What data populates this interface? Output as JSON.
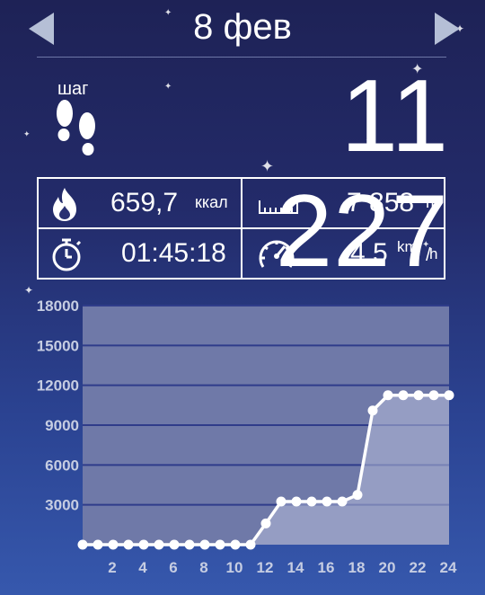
{
  "header": {
    "date": "8 фев"
  },
  "steps": {
    "label": "шаг",
    "value": "11 227"
  },
  "stats": {
    "calories": {
      "value": "659,7",
      "unit": "ккал"
    },
    "distance": {
      "value": "7 858",
      "unit": "m"
    },
    "duration": {
      "value": "01:45:18"
    },
    "speed": {
      "value": "4,5",
      "unit_top": "km",
      "unit_bottom": "h"
    }
  },
  "icons": {
    "prev": "triangle-left-icon",
    "next": "triangle-right-icon",
    "steps": "footprints-icon",
    "calories": "flame-icon",
    "distance": "ruler-icon",
    "duration": "stopwatch-icon",
    "speed": "speedometer-icon"
  },
  "colors": {
    "plot_area": "#6f79a8",
    "line": "#ffffff",
    "tick_label": "#c6cde2",
    "gridline": "#2f3c8a"
  },
  "chart_data": {
    "type": "line",
    "title": "",
    "xlabel": "",
    "ylabel": "",
    "ylim": [
      0,
      18000
    ],
    "xlim": [
      0,
      24
    ],
    "yticks": [
      3000,
      6000,
      9000,
      12000,
      15000,
      18000
    ],
    "ytick_labels": [
      "3000",
      "6000",
      "9000",
      "12000",
      "15000",
      "18000"
    ],
    "xticks": [
      2,
      4,
      6,
      8,
      10,
      12,
      14,
      16,
      18,
      20,
      22,
      24
    ],
    "xtick_labels": [
      "2",
      "4",
      "6",
      "8",
      "10",
      "12",
      "14",
      "16",
      "18",
      "20",
      "22",
      "24"
    ],
    "grid": true,
    "fill": true,
    "series": [
      {
        "x": [
          0,
          1,
          2,
          3,
          4,
          5,
          6,
          7,
          8,
          9,
          10,
          11,
          12,
          13,
          14,
          15,
          16,
          17,
          18,
          19,
          20,
          21,
          22,
          23,
          24
        ],
        "values": [
          0,
          0,
          0,
          0,
          0,
          0,
          0,
          0,
          0,
          0,
          0,
          0,
          1600,
          3250,
          3250,
          3250,
          3250,
          3250,
          3750,
          10100,
          11250,
          11250,
          11250,
          11250,
          11250
        ]
      }
    ]
  }
}
